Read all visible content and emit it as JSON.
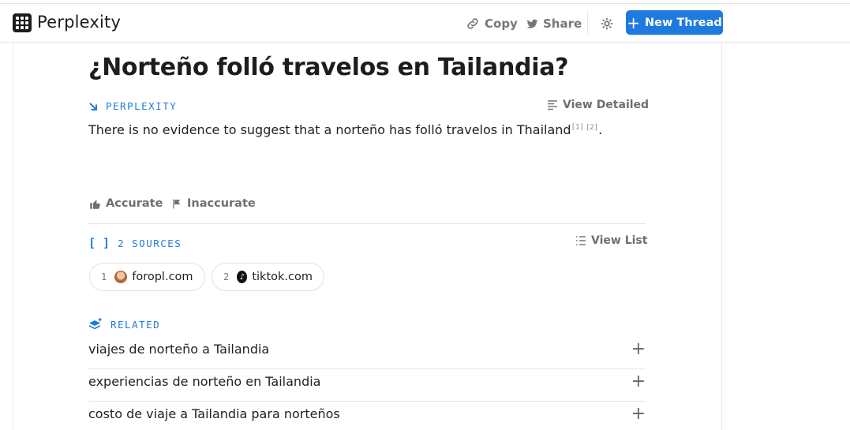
{
  "header": {
    "brand": "Perplexity",
    "copy_label": "Copy",
    "share_label": "Share",
    "new_thread_label": "New Thread"
  },
  "thread": {
    "question": "¿Norteño folló travelos en Tailandia?",
    "answer_label": "PERPLEXITY",
    "view_detailed": "View Detailed",
    "answer_text": "There is no evidence to suggest that a norteño has folló travelos in Thailand",
    "citations": [
      "[1]",
      "[2]"
    ],
    "answer_end": "."
  },
  "feedback": {
    "accurate": "Accurate",
    "inaccurate": "Inaccurate"
  },
  "sources": {
    "label": "2 SOURCES",
    "view_list": "View List",
    "items": [
      {
        "num": "1",
        "domain": "foropl.com",
        "icon": "foropl-favicon"
      },
      {
        "num": "2",
        "domain": "tiktok.com",
        "icon": "tiktok-favicon"
      }
    ]
  },
  "related": {
    "label": "RELATED",
    "items": [
      "viajes de norteño a Tailandia",
      "experiencias de norteño en Tailandia",
      "costo de viaje a Tailandia para norteños"
    ]
  },
  "colors": {
    "accent": "#1f7ae0",
    "text": "#1d1d1f",
    "muted": "#6f6f6f"
  }
}
